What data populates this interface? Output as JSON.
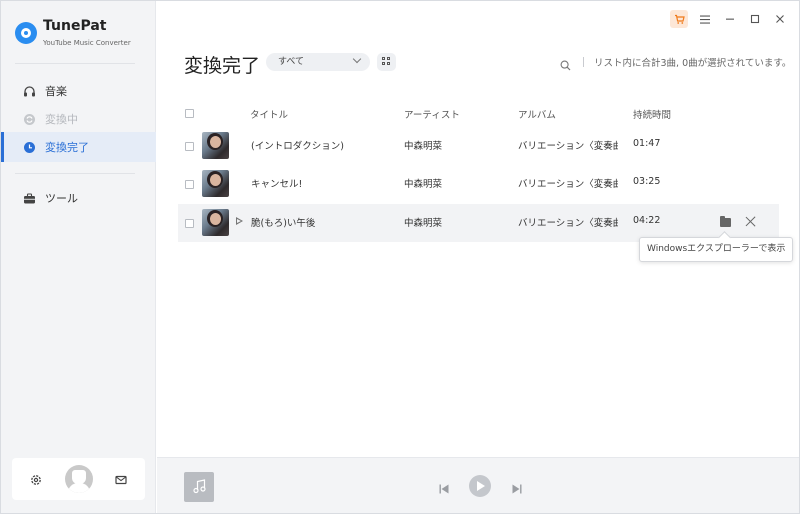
{
  "app": {
    "name": "TunePat",
    "subtitle": "YouTube Music Converter",
    "accent": "#2a6fd6",
    "cart_bg": "#fde7d7",
    "cart_icon": "cart-icon"
  },
  "sidebar": {
    "items": [
      {
        "label": "音楽",
        "icon": "headphones-icon",
        "state": "normal"
      },
      {
        "label": "変換中",
        "icon": "converting-icon",
        "state": "disabled"
      },
      {
        "label": "変換完了",
        "icon": "clock-icon",
        "state": "active"
      },
      {
        "label": "ツール",
        "icon": "toolbox-icon",
        "state": "normal"
      }
    ],
    "bottom": {
      "settings_icon": "gear-icon",
      "avatar": "avatar",
      "mail_icon": "mail-icon"
    }
  },
  "header": {
    "title": "変換完了",
    "filter": {
      "selected": "すべて"
    },
    "grid_icon": "grid-icon",
    "search_icon": "search-icon",
    "summary": "リスト内に合計3曲, 0曲が選択されています。"
  },
  "table": {
    "columns": {
      "title": "タイトル",
      "artist": "アーティスト",
      "album": "アルバム",
      "duration": "持続時間"
    },
    "rows": [
      {
        "title": "(イントロダクション)",
        "artist": "中森明菜",
        "album": "バリエーション〈変奏曲〉",
        "duration": "01:47"
      },
      {
        "title": "キャンセル!",
        "artist": "中森明菜",
        "album": "バリエーション〈変奏曲〉",
        "duration": "03:25"
      },
      {
        "title": "脆(もろ)い午後",
        "artist": "中森明菜",
        "album": "バリエーション〈変奏曲〉",
        "duration": "04:22"
      }
    ]
  },
  "tooltip": {
    "text": "Windowsエクスプローラーで表示"
  },
  "player": {
    "art_icon": "music-note-icon",
    "prev_icon": "skip-previous-icon",
    "play_icon": "play-icon",
    "next_icon": "skip-next-icon"
  }
}
